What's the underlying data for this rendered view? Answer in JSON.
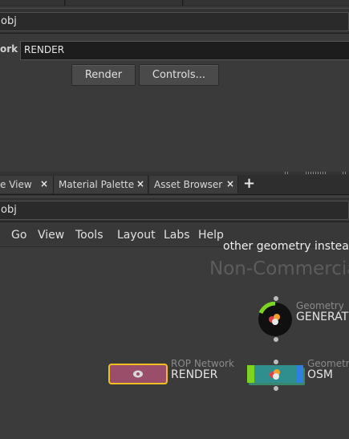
{
  "top_path": {
    "path": "obj"
  },
  "render_params": {
    "network_label": "ork",
    "network_value": "RENDER",
    "render_button": "Render",
    "controls_button": "Controls..."
  },
  "tabs": [
    {
      "label": "e View",
      "close": "×"
    },
    {
      "label": "Material Palette",
      "close": "×"
    },
    {
      "label": "Asset Browser",
      "close": "×"
    }
  ],
  "add_tab": "+",
  "network_path": {
    "path": "obj"
  },
  "menu": [
    "Go",
    "View",
    "Tools",
    "Layout",
    "Labs",
    "Help"
  ],
  "network": {
    "warning_text": "other geometry instead",
    "watermark": "Non-Commercial",
    "nodes": [
      {
        "type": "Geometry",
        "name": "GENERATOR"
      },
      {
        "type": "ROP Network",
        "name": "RENDER"
      },
      {
        "type": "Geometry",
        "name": "OSM"
      }
    ]
  },
  "colors": {
    "rop_node_fill": "#9a4e6a",
    "rop_node_border": "#f0c020",
    "osm_node_fill": "#2f8f8f",
    "osm_node_left": "#7cd421",
    "osm_node_right": "#2f7fe0",
    "generator_ring": "#7cd421"
  }
}
